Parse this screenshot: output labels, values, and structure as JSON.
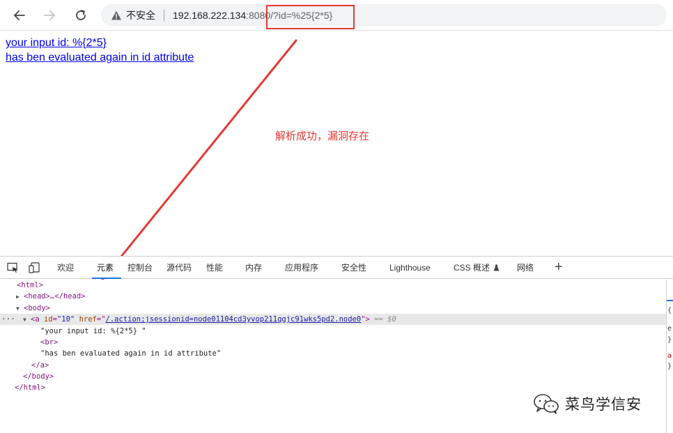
{
  "browser": {
    "security_label": "不安全",
    "url_host": "192.168.222.134",
    "url_port": ":8080",
    "url_path": "/",
    "url_query": "?id=%25{2*5}"
  },
  "page": {
    "link_line1": "your input id: %{2*5}",
    "link_line2": "has ben evaluated again in id attribute",
    "annotation": "解析成功，漏洞存在"
  },
  "devtools": {
    "tabs": [
      "欢迎",
      "元素",
      "控制台",
      "源代码",
      "性能",
      "内存",
      "应用程序",
      "安全性",
      "Lighthouse",
      "CSS 概述",
      "网络"
    ],
    "active_tab": "元素",
    "dom": {
      "html_open": "<html>",
      "head": "<head>…</head>",
      "body_open": "<body>",
      "a_tag_open": "<a ",
      "a_id_attr": "id",
      "a_id_value": "\"10\"",
      "a_href_attr": "href",
      "a_href_value": "/.action;jsessionid=node01104cd3yvop211qgjc91wks5pd2.node0",
      "a_tag_close": ">",
      "selected_marker": "== $0",
      "text1": "\"your input id: %{2*5} \"",
      "br": "<br>",
      "text2": "\"has ben evaluated again in id attribute\"",
      "a_close": "</a>",
      "body_close": "</body>",
      "html_close": "</html>"
    }
  },
  "watermark": {
    "text": "菜鸟学信安"
  }
}
